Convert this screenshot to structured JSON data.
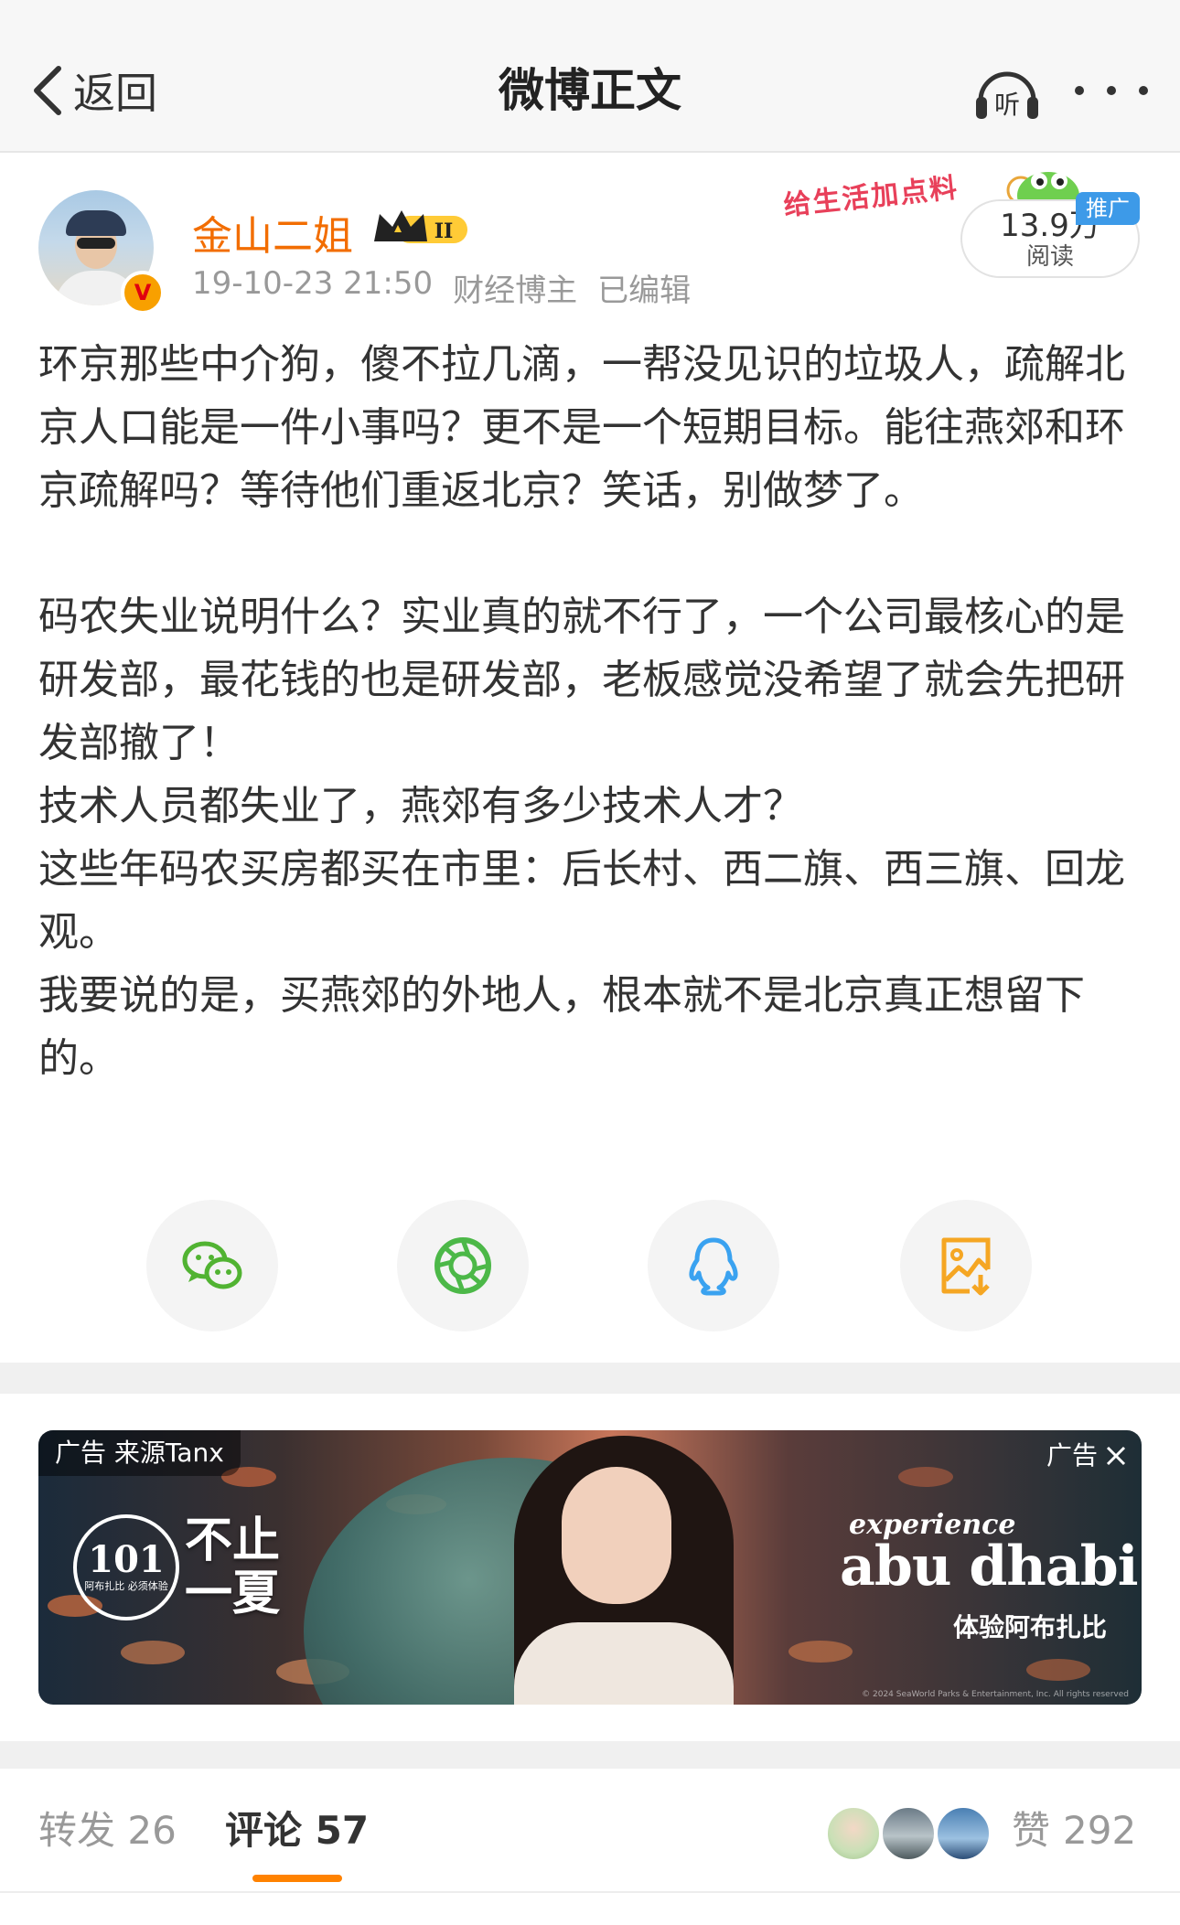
{
  "header": {
    "back_label": "返回",
    "title": "微博正文",
    "listen_label": "听"
  },
  "author": {
    "name": "金山二姐",
    "verified_mark": "V",
    "timestamp": "19-10-23 21:50",
    "category": "财经博主",
    "edited": "已编辑"
  },
  "promo": {
    "slogan": "给生活加点料",
    "reads": "13.9万",
    "reads_label": "阅读",
    "tag": "推广"
  },
  "post": {
    "paragraphs": [
      "环京那些中介狗，傻不拉几滴，一帮没见识的垃圾人，疏解北京人口能是一件小事吗？更不是一个短期目标。能往燕郊和环京疏解吗？等待他们重返北京？笑话，别做梦了。",
      "",
      "码农失业说明什么？实业真的就不行了，一个公司最核心的是研发部，最花钱的也是研发部，老板感觉没希望了就会先把研发部撤了！",
      "技术人员都失业了，燕郊有多少技术人才？",
      "这些年码农买房都买在市里：后长村、西二旗、西三旗、回龙观。",
      "我要说的是，买燕郊的外地人，根本就不是北京真正想留下的。"
    ]
  },
  "share": {
    "icons": [
      "wechat-icon",
      "moments-icon",
      "qq-icon",
      "save-image-icon"
    ],
    "colors": [
      "#51b332",
      "#4cb848",
      "#3aa2f0",
      "#f5a623"
    ]
  },
  "ad": {
    "source": "广告 来源Tanx",
    "corner_label": "广告",
    "logo_number": "101",
    "logo_sub": "阿布扎比 必须体验",
    "headline": "不止一夏",
    "tagline": "experience",
    "brand": "abu dhabi",
    "brand_cn": "体验阿布扎比",
    "copyright": "© 2024 SeaWorld Parks & Entertainment, Inc. All rights reserved"
  },
  "tabs": {
    "repost": "转发 26",
    "comment": "评论 57"
  },
  "likes": {
    "label": "赞",
    "count": "292"
  },
  "colors": {
    "accent": "#ff8200",
    "author_name": "#f26d00",
    "text": "#333333",
    "muted": "#999999",
    "promo_tag": "#3d9ae8"
  }
}
